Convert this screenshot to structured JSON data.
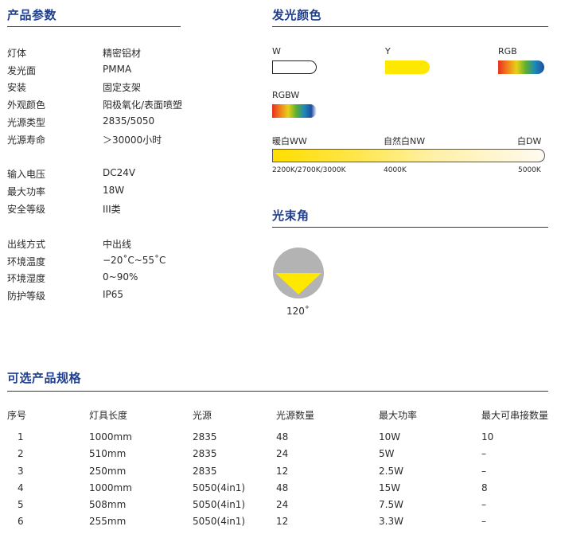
{
  "product_params": {
    "title": "产品参数",
    "groups": [
      [
        {
          "key": "灯体",
          "value": "精密铝材"
        },
        {
          "key": "发光面",
          "value": "PMMA"
        },
        {
          "key": "安装",
          "value": "固定支架"
        },
        {
          "key": "外观颜色",
          "value": "阳极氧化/表面喷塑"
        },
        {
          "key": "光源类型",
          "value": "2835/5050"
        },
        {
          "key": "光源寿命",
          "value": "＞30000小时"
        }
      ],
      [
        {
          "key": "输入电压",
          "value": "DC24V"
        },
        {
          "key": "最大功率",
          "value": "18W"
        },
        {
          "key": "安全等级",
          "value": "III类"
        }
      ],
      [
        {
          "key": "出线方式",
          "value": "中出线"
        },
        {
          "key": "环境温度",
          "value": "−20˚C~55˚C"
        },
        {
          "key": "环境湿度",
          "value": "0~90%"
        },
        {
          "key": "防护等级",
          "value": "IP65"
        }
      ]
    ]
  },
  "light_color": {
    "title": "发光颜色",
    "swatches": [
      {
        "label": "W",
        "color": "#ffffff"
      },
      {
        "label": "Y",
        "color": "#ffe800"
      },
      {
        "label": "RGB",
        "color": "gradient"
      },
      {
        "label": "RGBW",
        "color": "gradient"
      }
    ],
    "cct": {
      "labels": [
        "暖白WW",
        "自然白NW",
        "白DW"
      ],
      "ticks": [
        "2200K/2700K/3000K",
        "4000K",
        "5000K"
      ]
    }
  },
  "beam_angle": {
    "title": "光束角",
    "value": "120˚"
  },
  "optional_specs": {
    "title": "可选产品规格",
    "headers": [
      "序号",
      "灯具长度",
      "光源",
      "光源数量",
      "最大功率",
      "最大可串接数量"
    ],
    "rows": [
      [
        "1",
        "1000mm",
        "2835",
        "48",
        "10W",
        "10"
      ],
      [
        "2",
        "510mm",
        "2835",
        "24",
        "5W",
        "–"
      ],
      [
        "3",
        "250mm",
        "2835",
        "12",
        "2.5W",
        "–"
      ],
      [
        "4",
        "1000mm",
        "5050(4in1)",
        "48",
        "15W",
        "8"
      ],
      [
        "5",
        "508mm",
        "5050(4in1)",
        "24",
        "7.5W",
        "–"
      ],
      [
        "6",
        "255mm",
        "5050(4in1)",
        "12",
        "3.3W",
        "–"
      ]
    ]
  },
  "colors": {
    "heading": "#1f3f8f",
    "beam_yellow": "#ffe800",
    "beam_gray": "#b3b3b3"
  }
}
